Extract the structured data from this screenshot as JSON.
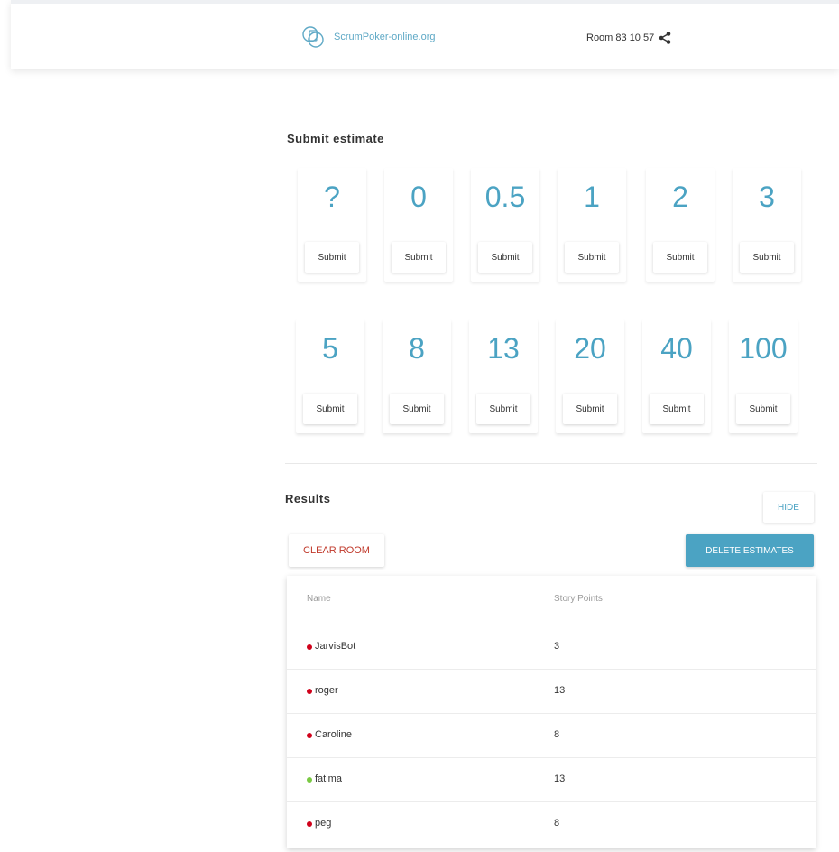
{
  "header": {
    "brand_name": "ScrumPoker-online.org",
    "room_label": "Room 83 10 57",
    "icons": {
      "logo": "brand-logo-icon",
      "share": "share-icon"
    }
  },
  "estimate": {
    "title": "Submit estimate",
    "cards": [
      {
        "value": "?",
        "button": "Submit"
      },
      {
        "value": "0",
        "button": "Submit"
      },
      {
        "value": "0.5",
        "button": "Submit"
      },
      {
        "value": "1",
        "button": "Submit"
      },
      {
        "value": "2",
        "button": "Submit"
      },
      {
        "value": "3",
        "button": "Submit"
      },
      {
        "value": "5",
        "button": "Submit"
      },
      {
        "value": "8",
        "button": "Submit"
      },
      {
        "value": "13",
        "button": "Submit"
      },
      {
        "value": "20",
        "button": "Submit"
      },
      {
        "value": "40",
        "button": "Submit"
      },
      {
        "value": "100",
        "button": "Submit"
      }
    ]
  },
  "results": {
    "title": "Results",
    "hide_label": "HIDE",
    "clear_label": "CLEAR ROOM",
    "delete_label": "DELETE ESTIMATES",
    "columns": [
      "Name",
      "Story Points"
    ],
    "rows": [
      {
        "name": "JarvisBot",
        "points": "3",
        "status": "offline"
      },
      {
        "name": "roger",
        "points": "13",
        "status": "offline"
      },
      {
        "name": "Caroline",
        "points": "8",
        "status": "offline"
      },
      {
        "name": "fatima",
        "points": "13",
        "status": "online"
      },
      {
        "name": "peg",
        "points": "8",
        "status": "offline"
      }
    ]
  },
  "colors": {
    "accent": "#4ba3c3",
    "danger": "#c0392b",
    "online": "#7ac943",
    "offline": "#d0021b"
  }
}
